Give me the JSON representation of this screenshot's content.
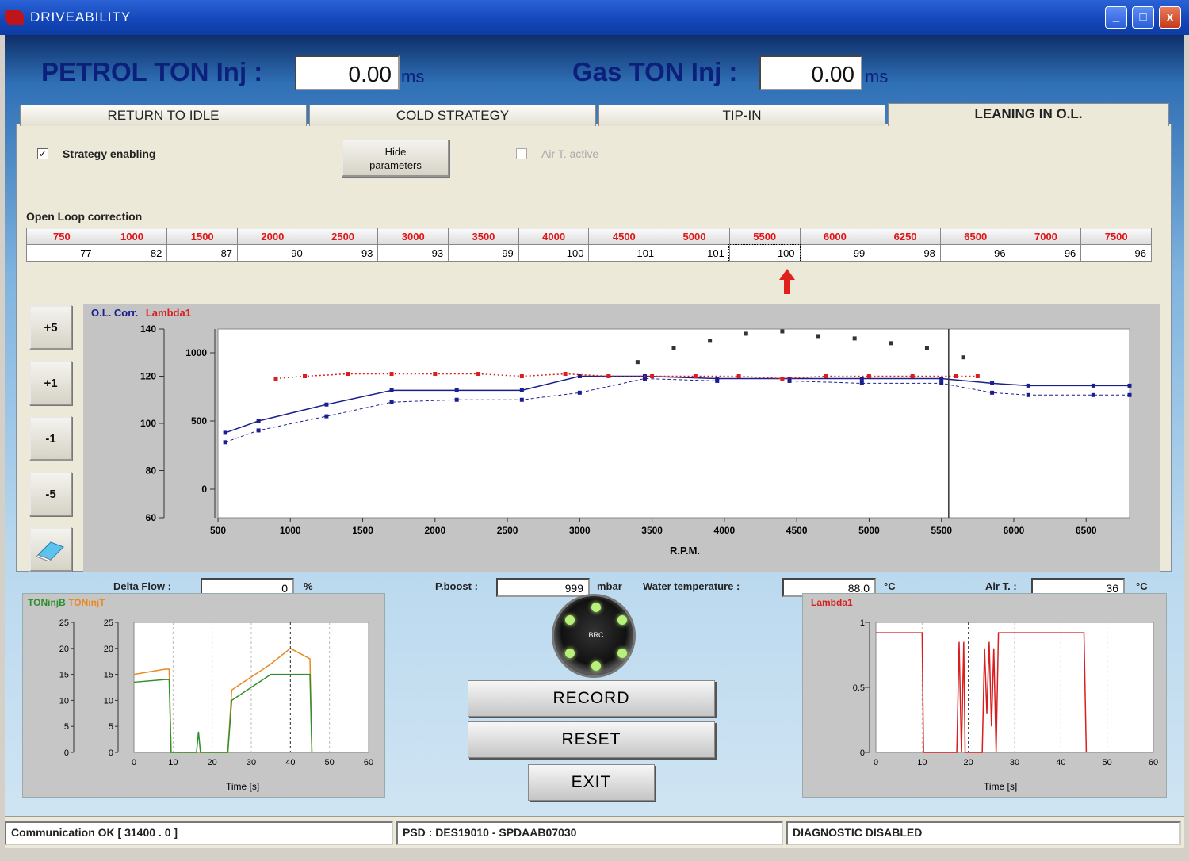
{
  "window": {
    "title": "DRIVEABILITY",
    "buttons": {
      "min": "_",
      "max": "□",
      "close": "x"
    }
  },
  "petrol": {
    "label": "PETROL TON Inj :",
    "value": "0.00",
    "unit": "ms"
  },
  "gas": {
    "label": "Gas TON Inj :",
    "value": "0.00",
    "unit": "ms"
  },
  "tabs": [
    {
      "label": "RETURN TO IDLE"
    },
    {
      "label": "COLD STRATEGY"
    },
    {
      "label": "TIP-IN"
    },
    {
      "label": "LEANING IN O.L."
    }
  ],
  "active_tab": "LEANING IN O.L.",
  "options": {
    "strategy_enabling": {
      "label": "Strategy enabling",
      "checked": true
    },
    "hide_parameters": {
      "line1": "Hide",
      "line2": "parameters"
    },
    "air_t_active": {
      "label": "Air T. active",
      "checked": false
    }
  },
  "open_loop": {
    "title": "Open Loop correction",
    "rpm": [
      "750",
      "1000",
      "1500",
      "2000",
      "2500",
      "3000",
      "3500",
      "4000",
      "4500",
      "5000",
      "5500",
      "6000",
      "6250",
      "6500",
      "7000",
      "7500"
    ],
    "values": [
      "77",
      "82",
      "87",
      "90",
      "93",
      "93",
      "99",
      "100",
      "101",
      "101",
      "100",
      "99",
      "98",
      "96",
      "96",
      "96"
    ],
    "selected_rpm": "5500"
  },
  "side_buttons": [
    "+5",
    "+1",
    "-1",
    "-5"
  ],
  "eraser_icon": "eraser-icon",
  "chart_data": {
    "type": "line",
    "legend": [
      "O.L. Corr.",
      "Lambda1"
    ],
    "ylabel_left_ticks": [
      "140",
      "120",
      "100",
      "80",
      "60"
    ],
    "ylabel_right_ticks": [
      "1000",
      "500",
      "0"
    ],
    "x_ticks": [
      "500",
      "1000",
      "1500",
      "2000",
      "2500",
      "3000",
      "3500",
      "4000",
      "4500",
      "5000",
      "5500",
      "6000",
      "6500"
    ],
    "xlabel": "R.P.M.",
    "ylim": [
      60,
      140
    ],
    "xlim": [
      500,
      6800
    ],
    "cursor_x": 5550,
    "series": [
      {
        "name": "O.L. Corr.",
        "color": "#1a1f8f",
        "x": [
          550,
          780,
          1250,
          1700,
          2150,
          2600,
          3000,
          3450,
          3950,
          4450,
          4950,
          5500,
          5850,
          6100,
          6550,
          6800
        ],
        "y": [
          96,
          101,
          108,
          114,
          114,
          114,
          120,
          120,
          119,
          119,
          119,
          119,
          117,
          116,
          116,
          116
        ]
      },
      {
        "name": "O.L. Corr. 2",
        "color": "#1a1f8f",
        "x": [
          550,
          780,
          1250,
          1700,
          2150,
          2600,
          3000,
          3450,
          3950,
          4450,
          4950,
          5500,
          5850,
          6100,
          6550,
          6800
        ],
        "y": [
          92,
          97,
          103,
          109,
          110,
          110,
          113,
          119,
          118,
          118,
          117,
          117,
          113,
          112,
          112,
          112
        ]
      },
      {
        "name": "Lambda1",
        "color": "#d81e1e",
        "x": [
          900,
          1100,
          1400,
          1700,
          2000,
          2300,
          2600,
          2900,
          3200,
          3500,
          3800,
          4100,
          4400,
          4700,
          5000,
          5300,
          5600,
          5750
        ],
        "y": [
          119,
          120,
          121,
          121,
          121,
          121,
          120,
          121,
          120,
          120,
          120,
          120,
          119,
          120,
          120,
          120,
          120,
          120
        ]
      },
      {
        "name": "dots",
        "color": "#333333",
        "x": [
          3400,
          3650,
          3900,
          4150,
          4400,
          4650,
          4900,
          5150,
          5400,
          5650
        ],
        "y": [
          126,
          132,
          135,
          138,
          139,
          137,
          136,
          134,
          132,
          128
        ]
      }
    ]
  },
  "footer": {
    "delta_flow": {
      "label": "Delta Flow :",
      "value": "0",
      "unit": "%"
    },
    "p_boost": {
      "label": "P.boost :",
      "value": "999",
      "unit": "mbar"
    },
    "water_temp": {
      "label": "Water temperature :",
      "value": "88.0",
      "unit": "°C"
    },
    "air_t": {
      "label": "Air T. :",
      "value": "36",
      "unit": "°C"
    }
  },
  "mini_left": {
    "legend1": "TONinjB",
    "legend2": "TONinjT",
    "legend1_color": "#2f8f2f",
    "legend2_color": "#e88a20",
    "y_ticks": [
      "25",
      "20",
      "15",
      "10",
      "5",
      "0"
    ],
    "x_ticks": [
      "0",
      "10",
      "20",
      "30",
      "40",
      "50",
      "60"
    ],
    "xlabel": "Time [s]"
  },
  "mini_right": {
    "legend": "Lambda1",
    "legend_color": "#d81e1e",
    "y_ticks": [
      "1",
      "0.5",
      "0"
    ],
    "x_ticks": [
      "0",
      "10",
      "20",
      "30",
      "40",
      "50",
      "60"
    ],
    "xlabel": "Time [s]"
  },
  "buttons": {
    "record": "RECORD",
    "reset": "RESET",
    "exit": "EXIT"
  },
  "logo_text": "BRC",
  "status": {
    "comm": "Communication OK [ 31400 . 0 ]",
    "psd": "PSD : DES19010 - SPDAAB07030",
    "diag": "DIAGNOSTIC DISABLED"
  }
}
